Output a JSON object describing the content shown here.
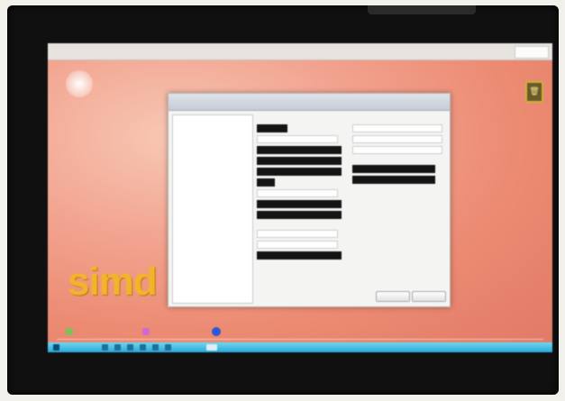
{
  "desktop": {
    "menu_items": [
      "",
      "",
      "",
      "",
      ""
    ],
    "logo_text": "simd",
    "trash_glyph": "🗑"
  },
  "dialog": {
    "title": "",
    "section_header": "",
    "nav_items": [
      "",
      "",
      "",
      "",
      "",
      "",
      "",
      "",
      "",
      "",
      "",
      "",
      "",
      "",
      "",
      "",
      "",
      "",
      "",
      "",
      "",
      "",
      ""
    ],
    "ok_label": "",
    "cancel_label": ""
  },
  "taskbar": {
    "clock": ""
  },
  "colors": {
    "screen_bg": "#ec8a72",
    "logo": "#f2b52a",
    "taskbar": "#29a8d9",
    "redacted": "#141414"
  },
  "icons": [
    "trash-icon",
    "dock-icon",
    "start-icon"
  ]
}
